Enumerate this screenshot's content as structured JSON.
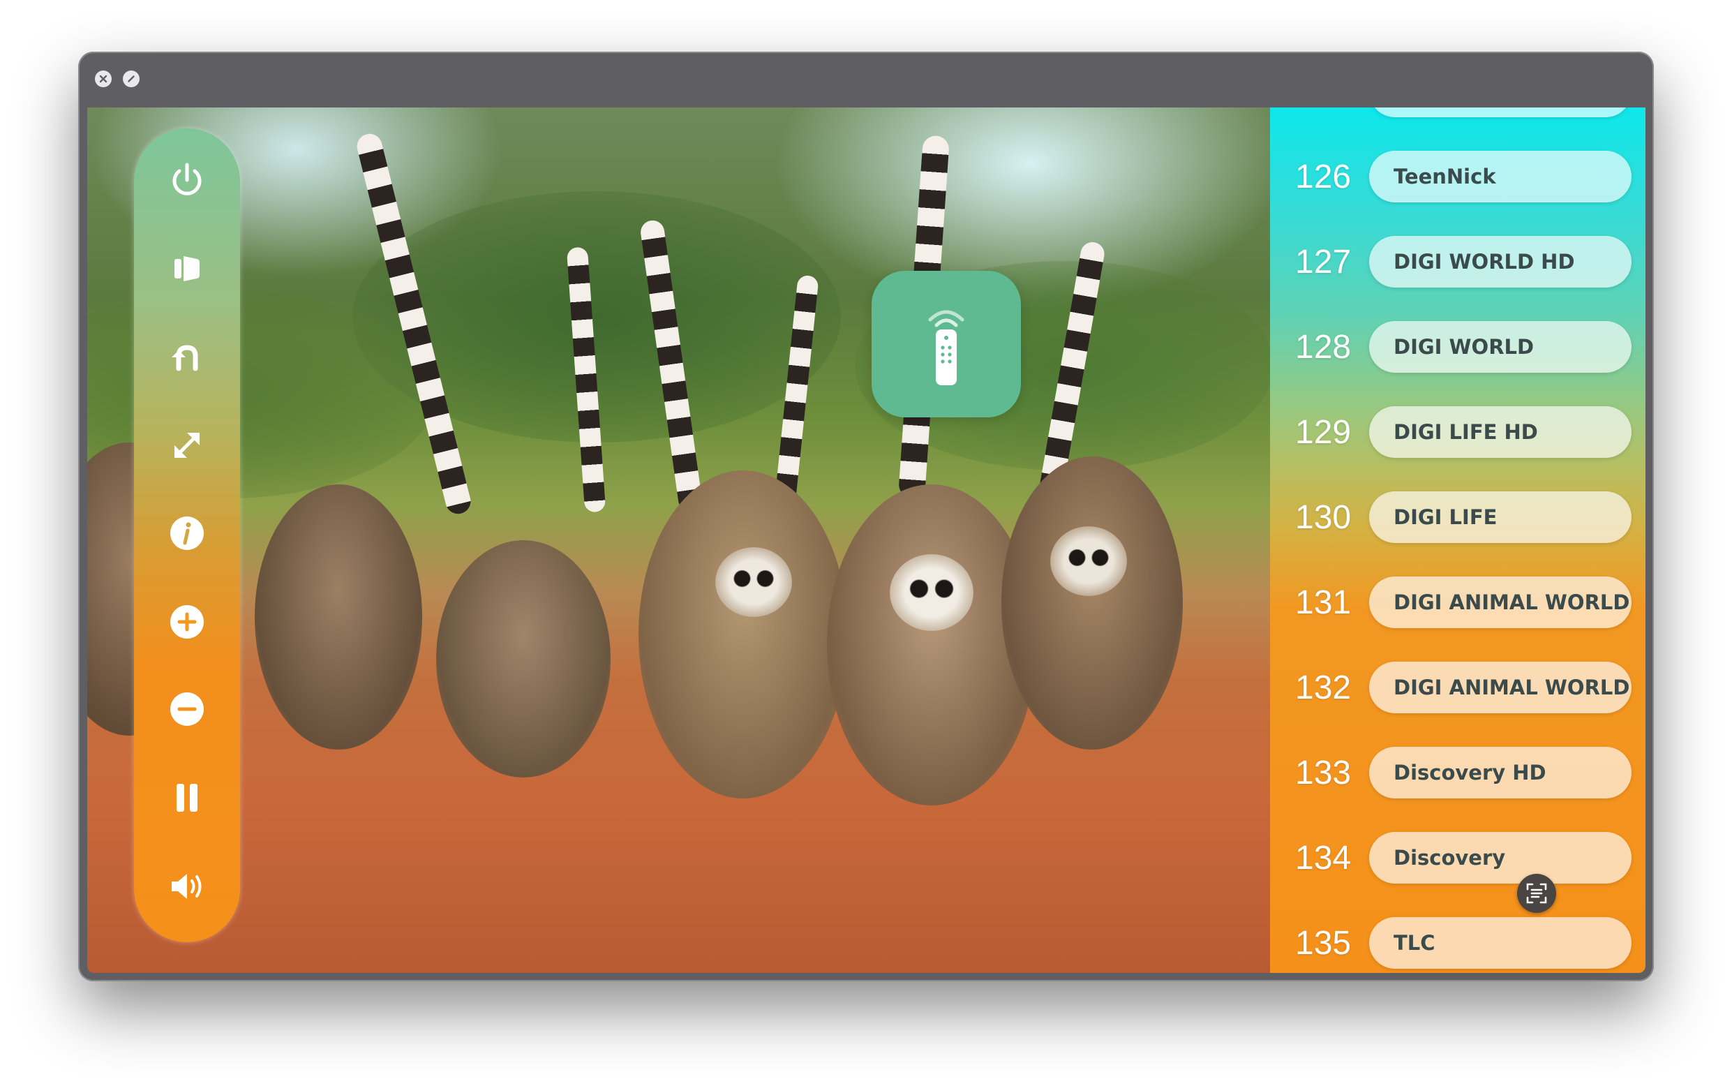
{
  "window": {
    "controls": [
      {
        "name": "close",
        "icon": "close-icon"
      },
      {
        "name": "minimize",
        "icon": "minimize-icon"
      }
    ]
  },
  "sidebar": {
    "buttons": [
      {
        "name": "power",
        "icon": "power-icon"
      },
      {
        "name": "input-source",
        "icon": "input-source-icon"
      },
      {
        "name": "back",
        "icon": "back-arrow-icon"
      },
      {
        "name": "fullscreen",
        "icon": "expand-icon"
      },
      {
        "name": "info",
        "icon": "info-icon"
      },
      {
        "name": "volume-up",
        "icon": "plus-circle-icon"
      },
      {
        "name": "volume-down",
        "icon": "minus-circle-icon"
      },
      {
        "name": "pause",
        "icon": "pause-icon"
      },
      {
        "name": "sound",
        "icon": "speaker-icon"
      }
    ]
  },
  "remote_logo": {
    "icon": "remote-control-icon",
    "color": "#5fba92"
  },
  "channels": [
    {
      "number": "126",
      "name": "TeenNick"
    },
    {
      "number": "127",
      "name": "DIGI WORLD HD"
    },
    {
      "number": "128",
      "name": "DIGI WORLD"
    },
    {
      "number": "129",
      "name": "DIGI LIFE HD"
    },
    {
      "number": "130",
      "name": "DIGI LIFE"
    },
    {
      "number": "131",
      "name": "DIGI ANIMAL WORLD"
    },
    {
      "number": "132",
      "name": "DIGI ANIMAL WORLD"
    },
    {
      "number": "133",
      "name": "Discovery HD"
    },
    {
      "number": "134",
      "name": "Discovery"
    },
    {
      "number": "135",
      "name": "TLC"
    }
  ],
  "scan_button": {
    "icon": "text-scan-icon"
  },
  "colors": {
    "accent_green": "#7ec69a",
    "accent_orange": "#f5901a",
    "accent_cyan": "#0ee7ea"
  }
}
